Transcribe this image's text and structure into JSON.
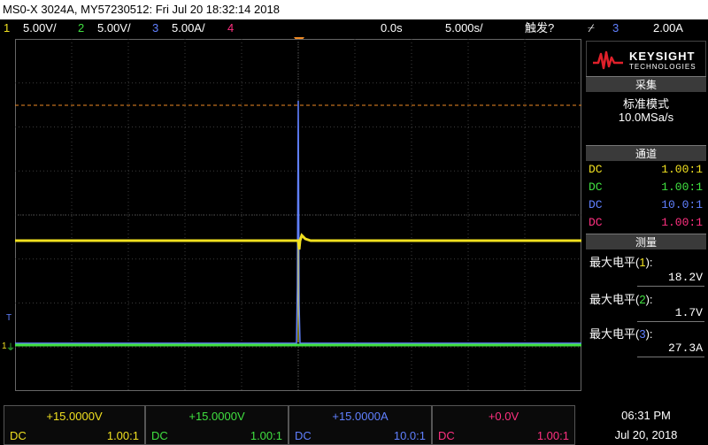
{
  "title": "MS0-X 3024A, MY57230512: Fri Jul 20 18:32:14 2018",
  "colors": {
    "ch1": "#f0e020",
    "ch2": "#40e040",
    "ch3": "#6080ff",
    "ch4": "#ff3080",
    "trigger": "#f08a24",
    "grid": "#3c3c3c"
  },
  "channels_bar": {
    "ch1": {
      "num": "1",
      "scale": "5.00V/"
    },
    "ch2": {
      "num": "2",
      "scale": "5.00V/"
    },
    "ch3": {
      "num": "3",
      "scale": "5.00A/"
    },
    "ch4": {
      "num": "4"
    },
    "delay": "0.0s",
    "timebase": "5.000s/",
    "trigger_status": "触发?",
    "trigger_source_num": "3",
    "trigger_level": "2.00A"
  },
  "markers": {
    "ch3_marker": "T",
    "ground_marker": "1"
  },
  "logo": {
    "brand": "KEYSIGHT",
    "sub": "TECHNOLOGIES"
  },
  "acquisition": {
    "header": "采集",
    "mode": "标准模式",
    "rate": "10.0MSa/s"
  },
  "channels_panel": {
    "header": "通道",
    "rows": [
      {
        "coupling": "DC",
        "probe": "1.00:1"
      },
      {
        "coupling": "DC",
        "probe": "1.00:1"
      },
      {
        "coupling": "DC",
        "probe": "10.0:1"
      },
      {
        "coupling": "DC",
        "probe": "1.00:1"
      }
    ]
  },
  "measurements": {
    "header": "测量",
    "items": [
      {
        "label": "最大电平",
        "num": "1",
        "value": "18.2V"
      },
      {
        "label": "最大电平",
        "num": "2",
        "value": "1.7V"
      },
      {
        "label": "最大电平",
        "num": "3",
        "value": "27.3A"
      }
    ]
  },
  "bottom": [
    {
      "offset": "+15.0000V",
      "coupling": "DC",
      "probe": "1.00:1"
    },
    {
      "offset": "+15.0000V",
      "coupling": "DC",
      "probe": "1.00:1"
    },
    {
      "offset": "+15.0000A",
      "coupling": "DC",
      "probe": "10.0:1"
    },
    {
      "offset": "+0.0V",
      "coupling": "DC",
      "probe": "1.00:1"
    }
  ],
  "clock": {
    "time": "06:31 PM",
    "date": "Jul 20, 2018"
  }
}
